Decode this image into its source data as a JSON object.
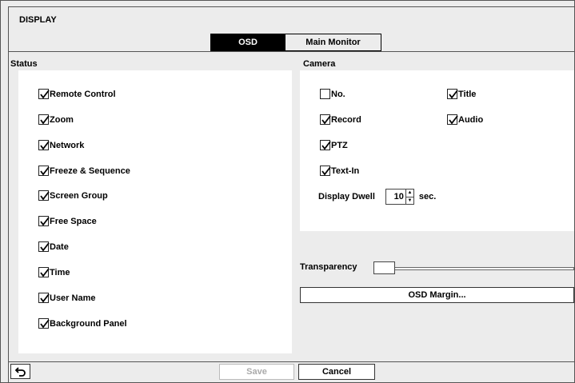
{
  "window": {
    "title": "DISPLAY"
  },
  "tabs": [
    {
      "label": "OSD",
      "active": true
    },
    {
      "label": "Main Monitor",
      "active": false
    }
  ],
  "status": {
    "label": "Status",
    "items": [
      {
        "label": "Remote Control",
        "checked": true
      },
      {
        "label": "Zoom",
        "checked": true
      },
      {
        "label": "Network",
        "checked": true
      },
      {
        "label": "Freeze & Sequence",
        "checked": true
      },
      {
        "label": "Screen Group",
        "checked": true
      },
      {
        "label": "Free Space",
        "checked": true
      },
      {
        "label": "Date",
        "checked": true
      },
      {
        "label": "Time",
        "checked": true
      },
      {
        "label": "User Name",
        "checked": true
      },
      {
        "label": "Background Panel",
        "checked": true
      }
    ]
  },
  "camera": {
    "label": "Camera",
    "items": [
      {
        "label": "No.",
        "checked": false
      },
      {
        "label": "Title",
        "checked": true
      },
      {
        "label": "Record",
        "checked": true
      },
      {
        "label": "Audio",
        "checked": true
      },
      {
        "label": "PTZ",
        "checked": true
      },
      {
        "label": "Text-In",
        "checked": true
      }
    ],
    "dwell_label": "Display Dwell",
    "dwell_value": "10",
    "dwell_unit": "sec."
  },
  "transparency": {
    "label": "Transparency",
    "level": 0
  },
  "osd_margin_button": "OSD Margin...",
  "footer": {
    "save": "Save",
    "cancel": "Cancel",
    "back_icon": "back-arrow-icon"
  }
}
